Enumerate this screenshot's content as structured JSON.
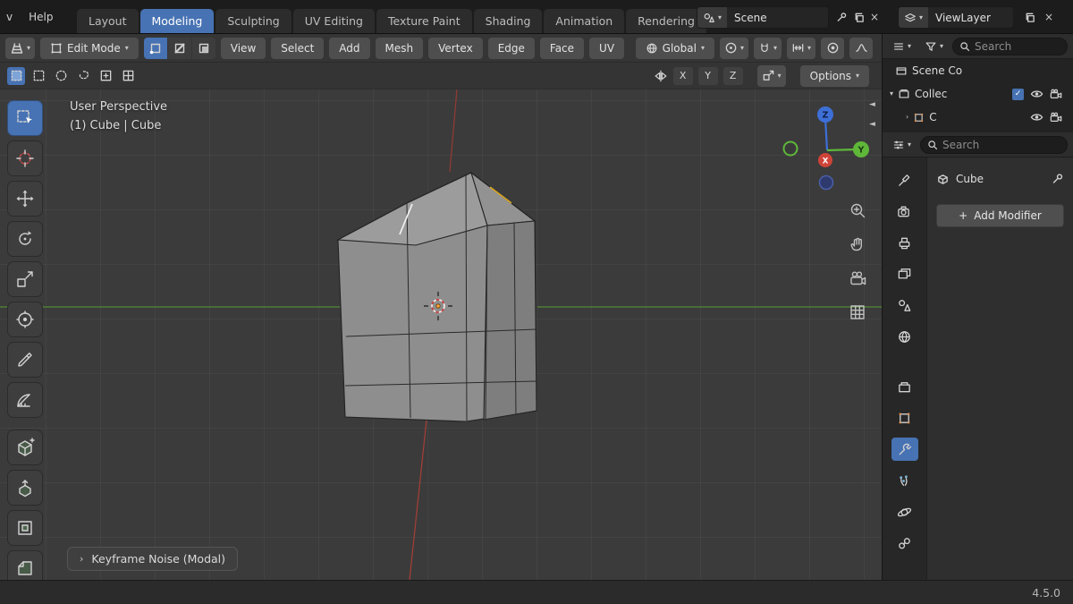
{
  "glyphs": {
    "chevron_down": "▾",
    "close": "×",
    "check": "✓",
    "expander": "›",
    "collapse_left": "◄",
    "plus": "+"
  },
  "colors": {
    "accent": "#4772b3",
    "axis_x": "#cf4439",
    "axis_y": "#5fb73a",
    "axis_z": "#3d6fd6",
    "edge_select_yellow": "#d7a51d"
  },
  "topbar": {
    "menu_clipped": "v",
    "menu_help": "Help",
    "tabs": [
      "Layout",
      "Modeling",
      "Sculpting",
      "UV Editing",
      "Texture Paint",
      "Shading",
      "Animation",
      "Rendering"
    ],
    "active_tab": "Modeling",
    "scene_label": "Scene",
    "viewlayer_label": "ViewLayer"
  },
  "header": {
    "mode_label": "Edit Mode",
    "menus": [
      "View",
      "Select",
      "Add",
      "Mesh",
      "Vertex",
      "Edge",
      "Face",
      "UV"
    ],
    "orientation_label": "Global"
  },
  "tool_settings": {
    "axes": [
      "X",
      "Y",
      "Z"
    ],
    "options_label": "Options"
  },
  "viewport": {
    "perspective_label": "User Perspective",
    "object_label": "(1) Cube | Cube",
    "modal_label": "Keyframe Noise (Modal)",
    "gizmo_x": "X",
    "gizmo_y": "Y",
    "gizmo_z": "Z"
  },
  "outliner": {
    "search_placeholder": "Search",
    "scene_collection_label": "Scene Co",
    "collection_label": "Collec",
    "object_label": "C"
  },
  "properties": {
    "search_placeholder": "Search",
    "object_name": "Cube",
    "add_modifier_label": "Add Modifier"
  },
  "statusbar": {
    "version": "4.5.0"
  }
}
